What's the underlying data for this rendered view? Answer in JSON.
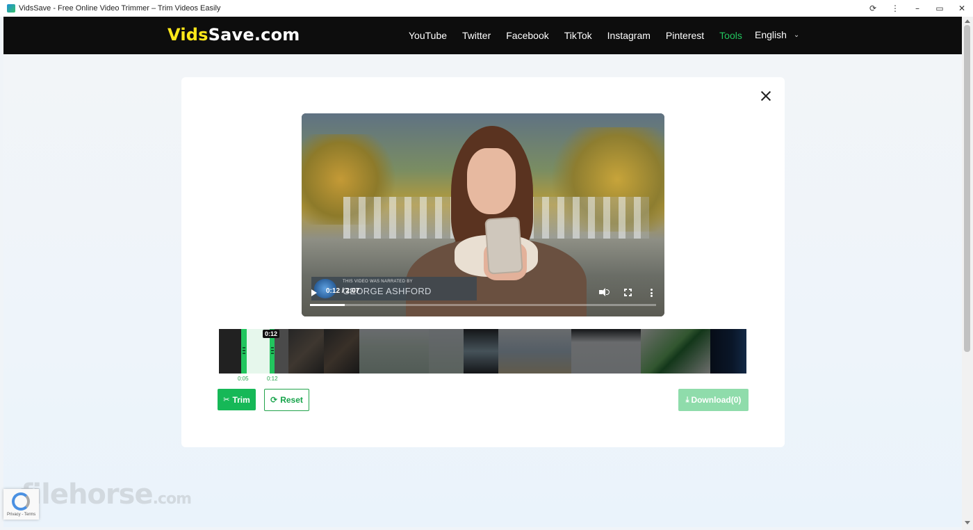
{
  "window": {
    "title": "VidsSave - Free Online Video Trimmer – Trim Videos Easily",
    "controls": [
      "⟳",
      "⋮",
      "–",
      "▭",
      "✕"
    ]
  },
  "site": {
    "logo_part1": "Vids",
    "logo_part2": "Save.com",
    "nav": [
      "YouTube",
      "Twitter",
      "Facebook",
      "TikTok",
      "Instagram",
      "Pinterest",
      "Tools"
    ],
    "active_nav": "Tools",
    "language": "English"
  },
  "player": {
    "badge_small": "THIS VIDEO WAS NARRATED BY",
    "badge_name": "GEORGE ASHFORD",
    "time": "0:12 / 2:07",
    "progress_fraction": 0.1
  },
  "trimmer": {
    "playhead_label": "0:12",
    "start_label": "0:05",
    "end_label": "0:12"
  },
  "actions": {
    "trim_label": "Trim",
    "reset_label": "Reset",
    "download_label": "Download(0)"
  },
  "misc": {
    "recaptcha_text": "Privacy - Terms",
    "watermark": "filehorse",
    "watermark_domain": ".com"
  },
  "colors": {
    "accent": "#16b857",
    "logo_yellow": "#ffe81a",
    "nav_bg": "#0d0d0d",
    "download_disabled": "#8fdcab"
  }
}
